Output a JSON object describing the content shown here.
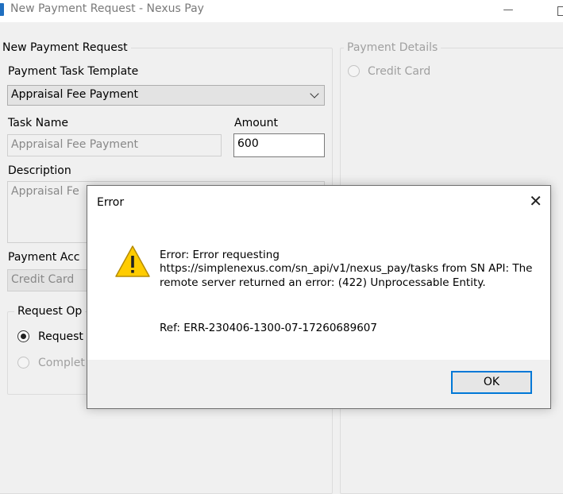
{
  "window": {
    "title": "New Payment Request - Nexus Pay"
  },
  "left_group": {
    "legend": "New Payment Request",
    "template_label": "Payment Task Template",
    "template_value": "Appraisal Fee Payment",
    "task_name_label": "Task Name",
    "task_name_value": "Appraisal Fee Payment",
    "amount_label": "Amount",
    "amount_value": "600",
    "description_label": "Description",
    "description_value": "Appraisal Fe",
    "payment_account_label": "Payment Acc",
    "payment_account_value": "Credit Card",
    "request_options": {
      "legend": "Request Op",
      "option1": "Request",
      "option2": "Complet"
    }
  },
  "right_group": {
    "legend": "Payment Details",
    "option": "Credit Card"
  },
  "dialog": {
    "title": "Error",
    "close_glyph": "✕",
    "message": "Error: Error requesting https://simplenexus.com/sn_api/v1/nexus_pay/tasks from SN API: The remote server returned an error: (422) Unprocessable Entity.",
    "reference": "Ref: ERR-230406-1300-07-17260689607",
    "ok_label": "OK"
  },
  "colors": {
    "accent": "#0078d7",
    "warning": "#ffcc00"
  }
}
